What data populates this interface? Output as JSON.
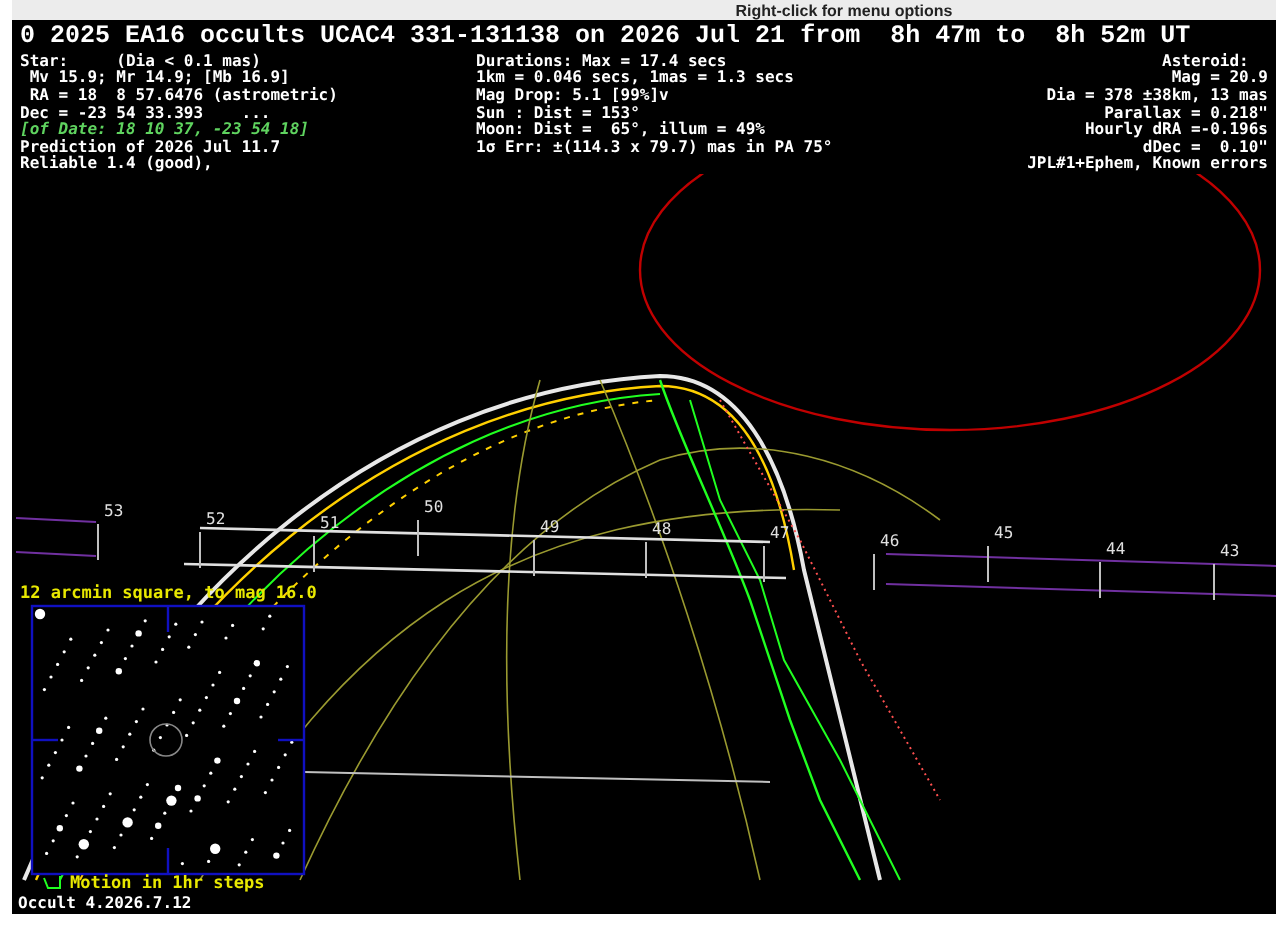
{
  "toolbar": {
    "hint": "Right-click for menu options"
  },
  "header": {
    "title": "0 2025 EA16 occults UCAC4 331-131138 on 2026 Jul 21 from  8h 47m to  8h 52m UT",
    "star_lines": [
      {
        "text": "Star:     (Dia < 0.1 mas)",
        "kind": "plain"
      },
      {
        "text": " Mv 15.9; Mr 14.9; [Mb 16.9]",
        "kind": "plain"
      },
      {
        "text": " RA = 18  8 57.6476 (astrometric)",
        "kind": "plain"
      },
      {
        "text": "Dec = -23 54 33.393    ...",
        "kind": "plain"
      },
      {
        "text": "[of Date: 18 10 37, -23 54 18]",
        "kind": "note"
      },
      {
        "text": "Prediction of 2026 Jul 11.7",
        "kind": "plain"
      },
      {
        "text": "Reliable 1.4 (good),",
        "kind": "plain"
      }
    ],
    "event_lines": [
      "Durations: Max = 17.4 secs",
      "1km = 0.046 secs, 1mas = 1.3 secs",
      "Mag Drop: 5.1 [99%]v",
      "Sun : Dist = 153°",
      "Moon: Dist =  65°, illum = 49%",
      "1σ Err: ±(114.3 x 79.7) mas in PA 75°"
    ],
    "asteroid_lines": [
      "Asteroid:  ",
      "Mag = 20.9",
      "Dia = 378 ±38km, 13 mas",
      "Parallax = 0.218\"",
      "Hourly dRA =-0.196s",
      "dDec =  0.10\"",
      "JPL#1+Ephem, Known errors"
    ]
  },
  "path_ticks": [
    "53",
    "52",
    "51",
    "50",
    "49",
    "48",
    "47",
    "46",
    "45",
    "44",
    "43"
  ],
  "inset": {
    "title": "12 arcmin square, to mag 16.0",
    "motion_label": "Motion in 1hr steps"
  },
  "version": "Occult 4.2026.7.12"
}
